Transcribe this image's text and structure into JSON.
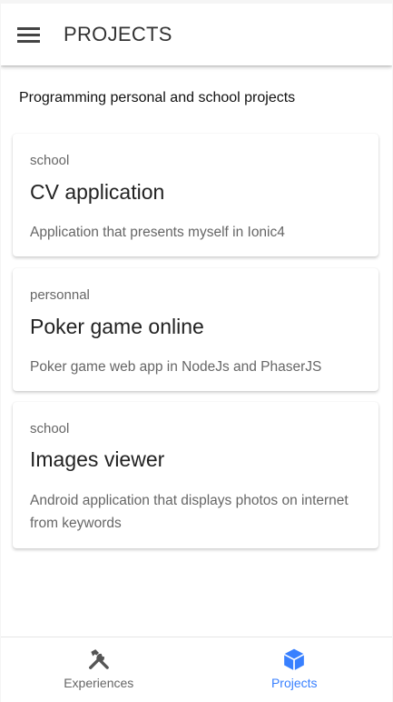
{
  "toolbar": {
    "title": "PROJECTS",
    "menu_icon": "menu-icon"
  },
  "subtitle": "Programming personal and school projects",
  "projects": [
    {
      "category": "school",
      "title": "CV application",
      "description": "Application that presents myself in Ionic4"
    },
    {
      "category": "personnal",
      "title": "Poker game online",
      "description": "Poker game web app in NodeJs and PhaserJS"
    },
    {
      "category": "school",
      "title": "Images viewer",
      "description": "Android application that displays photos on internet from keywords"
    }
  ],
  "tabs": [
    {
      "label": "Experiences",
      "icon": "hammer-wrench-icon",
      "selected": false
    },
    {
      "label": "Projects",
      "icon": "cube-icon",
      "selected": true
    }
  ],
  "colors": {
    "primary": "#3880ff",
    "tab_inactive": "#666666",
    "icon_dark": "#555555"
  }
}
